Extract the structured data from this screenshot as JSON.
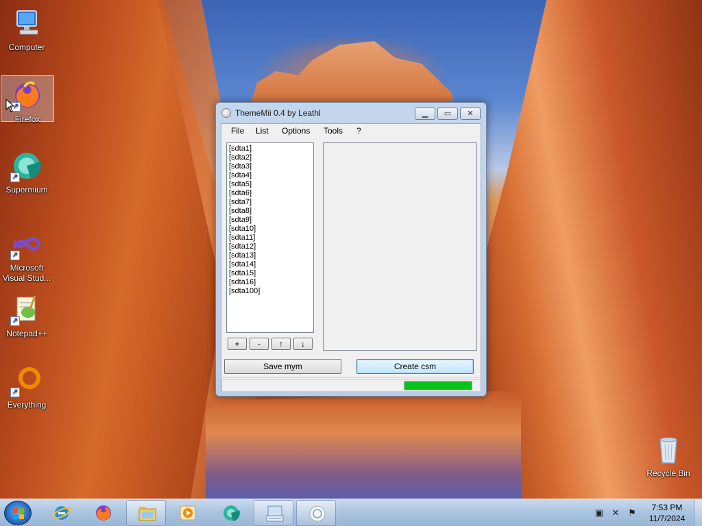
{
  "desktop": {
    "icons": [
      {
        "label": "Computer",
        "icon": "computer-icon"
      },
      {
        "label": "Firefox",
        "icon": "firefox-icon"
      },
      {
        "label": "Supermium",
        "icon": "supermium-icon"
      },
      {
        "label": "Microsoft Visual Stud...",
        "icon": "visual-studio-icon"
      },
      {
        "label": "Notepad++",
        "icon": "notepadpp-icon"
      },
      {
        "label": "Everything",
        "icon": "everything-icon"
      },
      {
        "label": "Recycle Bin",
        "icon": "recycle-bin-icon"
      }
    ]
  },
  "window": {
    "title": "ThemeMii 0.4 by Leathl",
    "menu": [
      "File",
      "List",
      "Options",
      "Tools",
      "?"
    ],
    "list_items": [
      "[sdta1]",
      "[sdta2]",
      "[sdta3]",
      "[sdta4]",
      "[sdta5]",
      "[sdta6]",
      "[sdta7]",
      "[sdta8]",
      "[sdta9]",
      "[sdta10]",
      "[sdta11]",
      "[sdta12]",
      "[sdta13]",
      "[sdta14]",
      "[sdta15]",
      "[sdta16]",
      "[sdta100]"
    ],
    "list_buttons": [
      "+",
      "-",
      "↑",
      "↓"
    ],
    "save_label": "Save mym",
    "create_label": "Create csm",
    "progress": 1.0,
    "progress_color": "#06c21a"
  },
  "taskbar": {
    "pinned": [
      "internet-explorer-icon",
      "firefox-icon",
      "file-explorer-icon",
      "media-player-icon",
      "supermium-icon",
      "keyboard-icon",
      "thememii-icon"
    ],
    "clock_time": "7:53 PM",
    "clock_date": "11/7/2024",
    "tray_icons": [
      "network-icon",
      "volume-muted-icon",
      "action-center-flag-icon"
    ]
  }
}
